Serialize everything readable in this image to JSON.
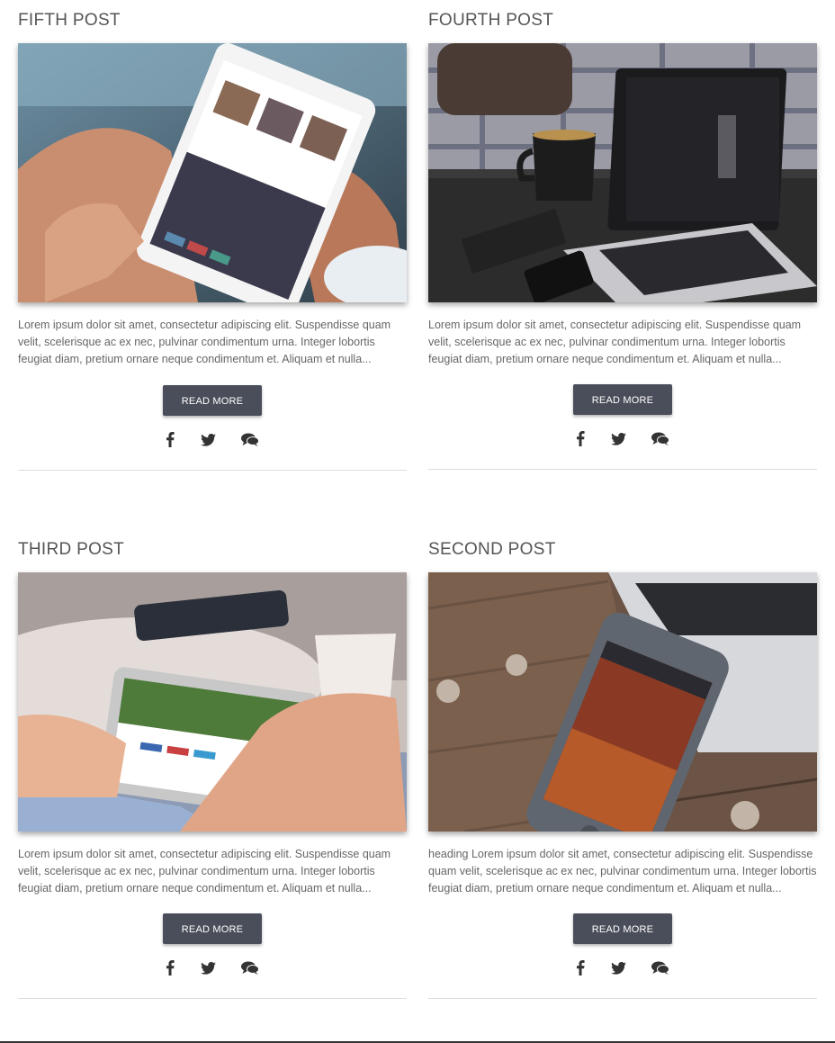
{
  "posts": [
    {
      "title": "FIFTH POST",
      "image_icon": "tablet-in-hands-photo",
      "excerpt": "Lorem ipsum dolor sit amet, consectetur adipiscing elit. Suspendisse quam velit, scelerisque ac ex nec, pulvinar condimentum urna. Integer lobortis feugiat diam, pretium ornare neque condimentum et. Aliquam et nulla...",
      "button": "READ MORE"
    },
    {
      "title": "FOURTH POST",
      "image_icon": "laptop-and-coffee-photo",
      "excerpt": "Lorem ipsum dolor sit amet, consectetur adipiscing elit. Suspendisse quam velit, scelerisque ac ex nec, pulvinar condimentum urna. Integer lobortis feugiat diam, pretium ornare neque condimentum et. Aliquam et nulla...",
      "button": "READ MORE"
    },
    {
      "title": "THIRD POST",
      "image_icon": "tablet-with-cup-photo",
      "excerpt": "Lorem ipsum dolor sit amet, consectetur adipiscing elit. Suspendisse quam velit, scelerisque ac ex nec, pulvinar condimentum urna. Integer lobortis feugiat diam, pretium ornare neque condimentum et. Aliquam et nulla...",
      "button": "READ MORE"
    },
    {
      "title": "SECOND POST",
      "image_icon": "phone-on-wood-photo",
      "excerpt": "heading Lorem ipsum dolor sit amet, consectetur adipiscing elit. Suspendisse quam velit, scelerisque ac ex nec, pulvinar condimentum urna. Integer lobortis feugiat diam, pretium ornare neque condimentum et. Aliquam et nulla...",
      "button": "READ MORE"
    }
  ],
  "share_icons": [
    "facebook-icon",
    "twitter-icon",
    "comments-icon"
  ],
  "colors": {
    "button_bg": "#4a4e5a",
    "title": "#555555",
    "text": "#666666",
    "divider": "#dddddd"
  }
}
